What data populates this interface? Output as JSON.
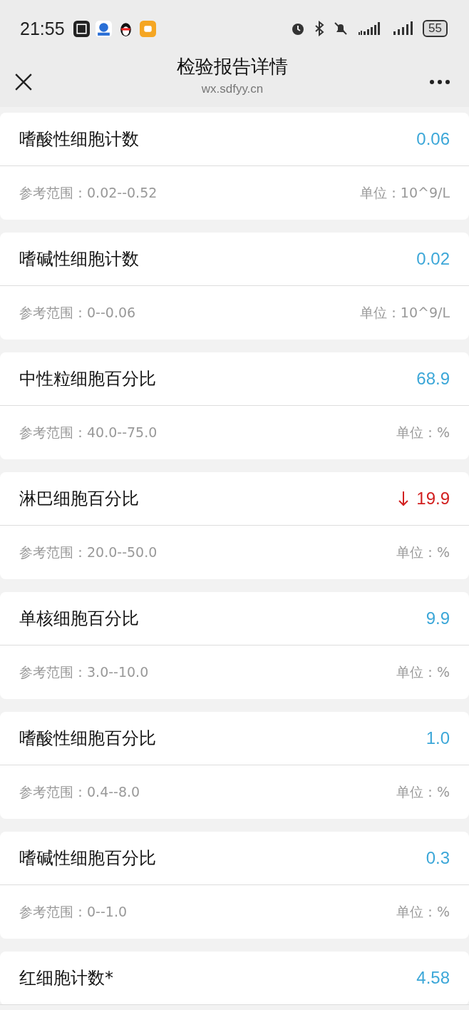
{
  "status_bar": {
    "time": "21:55",
    "battery": "55"
  },
  "header": {
    "title": "检验报告详情",
    "subtitle": "wx.sdfyy.cn"
  },
  "results": [
    {
      "name": "嗜酸性细胞计数",
      "value": "0.06",
      "low": false,
      "range": "参考范围：0.02--0.52",
      "unit": "单位：10^9/L"
    },
    {
      "name": "嗜碱性细胞计数",
      "value": "0.02",
      "low": false,
      "range": "参考范围：0--0.06",
      "unit": "单位：10^9/L"
    },
    {
      "name": "中性粒细胞百分比",
      "value": "68.9",
      "low": false,
      "range": "参考范围：40.0--75.0",
      "unit": "单位：%"
    },
    {
      "name": "淋巴细胞百分比",
      "value": "19.9",
      "low": true,
      "range": "参考范围：20.0--50.0",
      "unit": "单位：%"
    },
    {
      "name": "单核细胞百分比",
      "value": "9.9",
      "low": false,
      "range": "参考范围：3.0--10.0",
      "unit": "单位：%"
    },
    {
      "name": "嗜酸性细胞百分比",
      "value": "1.0",
      "low": false,
      "range": "参考范围：0.4--8.0",
      "unit": "单位：%"
    },
    {
      "name": "嗜碱性细胞百分比",
      "value": "0.3",
      "low": false,
      "range": "参考范围：0--1.0",
      "unit": "单位：%"
    },
    {
      "name": "红细胞计数*",
      "value": "4.58",
      "low": false
    }
  ]
}
